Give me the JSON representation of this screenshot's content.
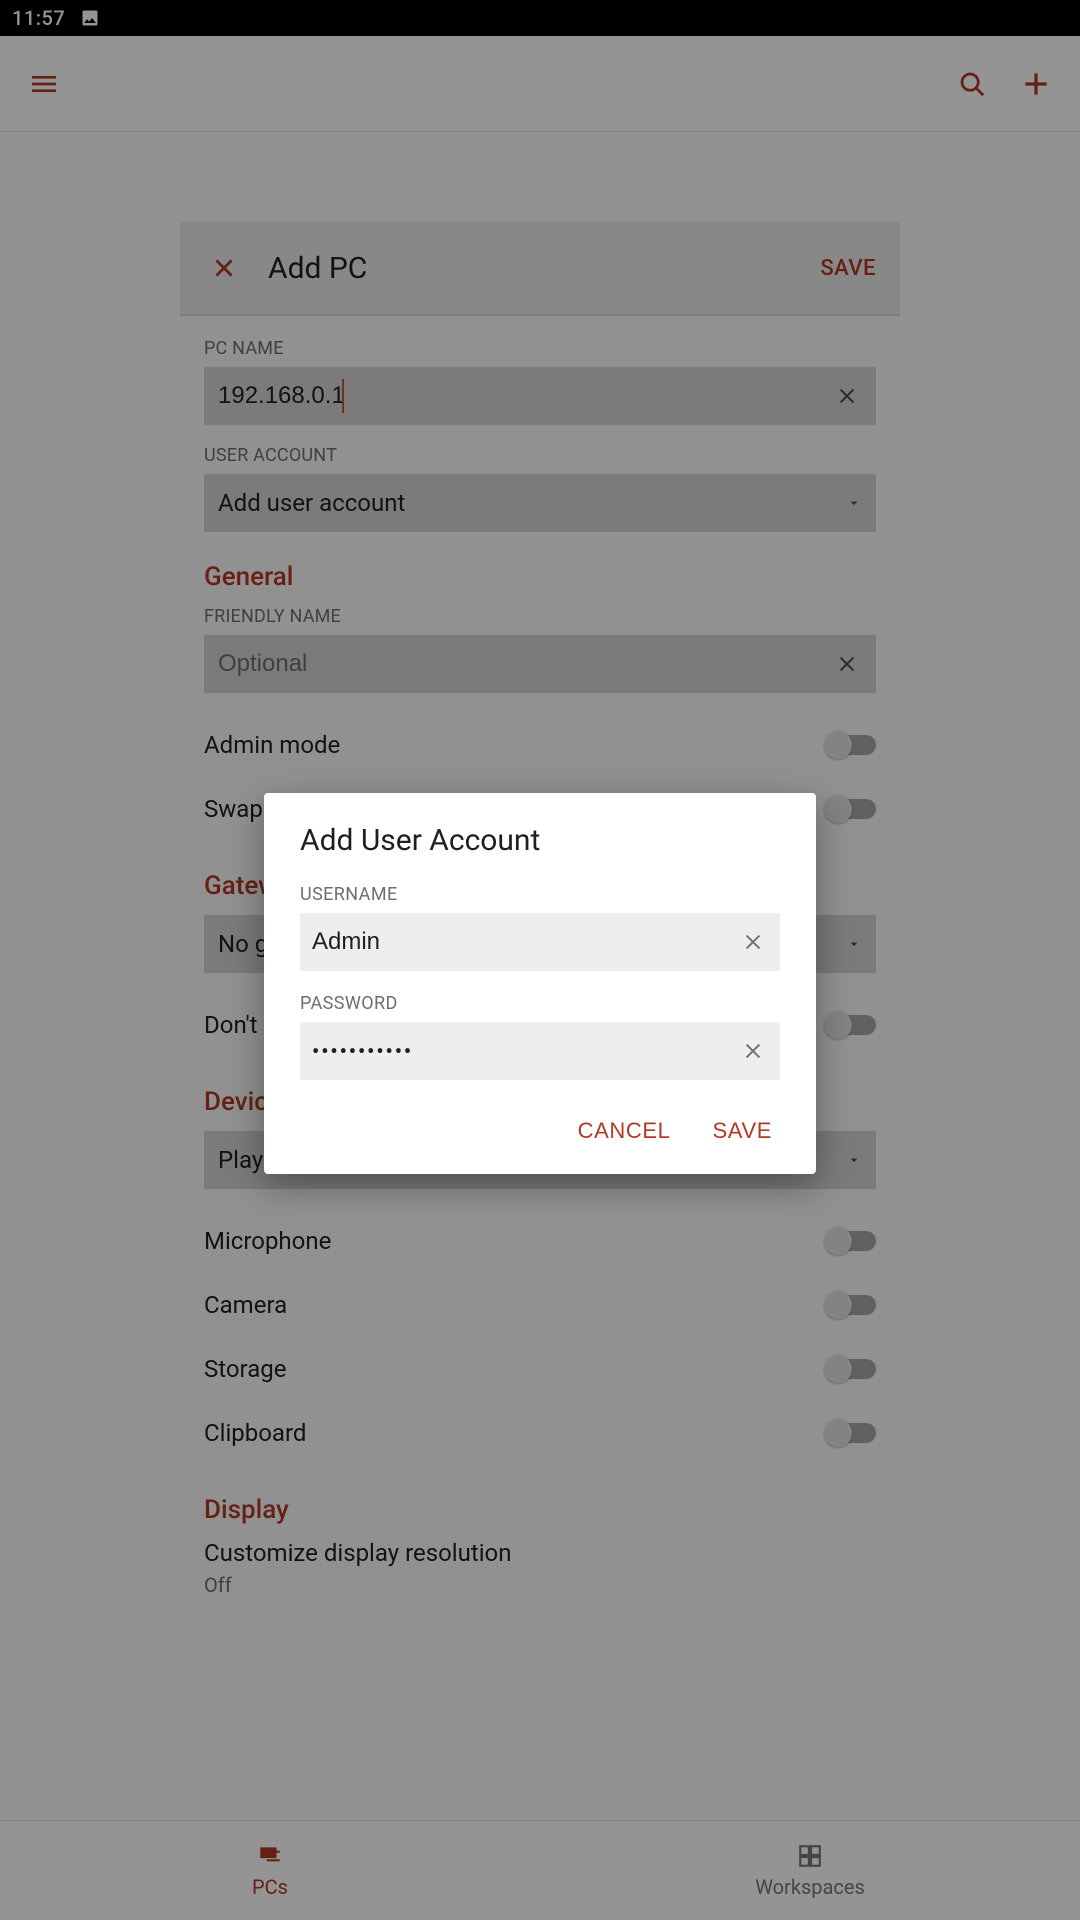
{
  "status": {
    "time": "11:57"
  },
  "appbar": {},
  "page": {
    "title": "Add PC",
    "save_label": "SAVE",
    "pc_name_label": "PC NAME",
    "pc_name_value": "192.168.0.1",
    "user_account_label": "USER ACCOUNT",
    "user_account_value": "Add user account",
    "sections": {
      "general": "General",
      "gateway": "Gateway",
      "devices": "Device & Audio Redirection",
      "display": "Display"
    },
    "friendly_name_label": "FRIENDLY NAME",
    "friendly_name_placeholder": "Optional",
    "toggles": {
      "admin": "Admin mode",
      "swap": "Swap mouse buttons",
      "no_gateway": "No gateway",
      "dont_ask": "Don't ask me again",
      "microphone": "Microphone",
      "camera": "Camera",
      "storage": "Storage",
      "clipboard": "Clipboard"
    },
    "audio_value": "Play sound on device",
    "display_item_label": "Customize display resolution",
    "display_item_value": "Off"
  },
  "nav": {
    "pcs": "PCs",
    "workspaces": "Workspaces"
  },
  "dialog": {
    "title": "Add User Account",
    "username_label": "USERNAME",
    "username_value": "Admin",
    "password_label": "PASSWORD",
    "password_masked": "•••••••••••",
    "cancel_label": "CANCEL",
    "save_label": "SAVE"
  }
}
